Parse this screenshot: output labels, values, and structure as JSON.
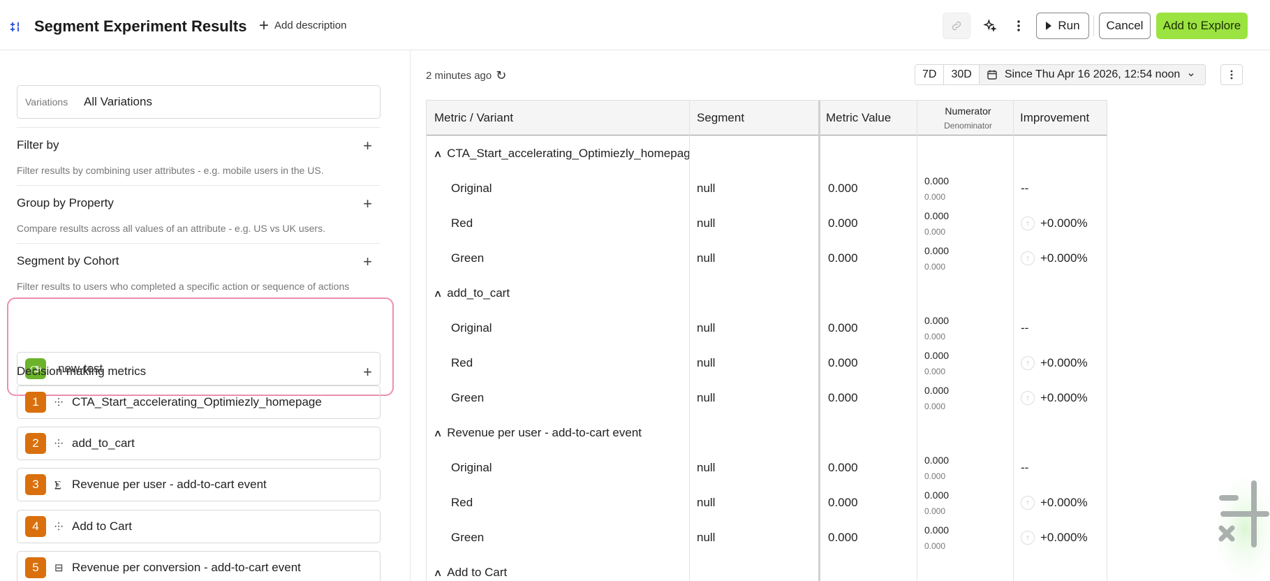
{
  "header": {
    "title": "Segment Experiment Results",
    "add_description": "Add description",
    "run_label": "Run",
    "cancel_label": "Cancel",
    "explore_label": "Add to Explore"
  },
  "variations": {
    "label": "Variations",
    "value": "All Variations"
  },
  "filter_by": {
    "title": "Filter by",
    "desc": "Filter results by combining user attributes - e.g. mobile users in the US."
  },
  "group_by": {
    "title": "Group by Property",
    "desc": "Compare results across all values of an attribute - e.g. US vs UK users."
  },
  "segment_by": {
    "title": "Segment by Cohort",
    "desc": "Filter results to users who completed a specific action or sequence of actions",
    "cohort": "new-test"
  },
  "metrics_section": {
    "title": "Decision-making metrics",
    "items": [
      {
        "num": "1",
        "name": "CTA_Start_accelerating_Optimiezly_homepage",
        "icon": "funnel-icon"
      },
      {
        "num": "2",
        "name": "add_to_cart",
        "icon": "funnel-icon"
      },
      {
        "num": "3",
        "name": "Revenue per user - add-to-cart event",
        "icon": "sum-icon"
      },
      {
        "num": "4",
        "name": "Add to Cart",
        "icon": "funnel-icon"
      },
      {
        "num": "5",
        "name": "Revenue per conversion - add-to-cart event",
        "icon": "calculator-icon"
      }
    ]
  },
  "results": {
    "updated": "2 minutes ago",
    "ranges": [
      "7D",
      "30D"
    ],
    "date_range": "Since Thu Apr 16 2026, 12:54 noon",
    "columns": {
      "metric": "Metric / Variant",
      "segment": "Segment",
      "value": "Metric Value",
      "numerator": "Numerator",
      "denominator": "Denominator",
      "improvement": "Improvement"
    },
    "groups": [
      {
        "name": "CTA_Start_accelerating_Optimiezly_homepage",
        "rows": [
          {
            "variant": "Original",
            "segment": "null",
            "value": "0.000",
            "num": "0.000",
            "den": "0.000",
            "impr": "--"
          },
          {
            "variant": "Red",
            "segment": "null",
            "value": "0.000",
            "num": "0.000",
            "den": "0.000",
            "impr": "+0.000%"
          },
          {
            "variant": "Green",
            "segment": "null",
            "value": "0.000",
            "num": "0.000",
            "den": "0.000",
            "impr": "+0.000%"
          }
        ]
      },
      {
        "name": "add_to_cart",
        "rows": [
          {
            "variant": "Original",
            "segment": "null",
            "value": "0.000",
            "num": "0.000",
            "den": "0.000",
            "impr": "--"
          },
          {
            "variant": "Red",
            "segment": "null",
            "value": "0.000",
            "num": "0.000",
            "den": "0.000",
            "impr": "+0.000%"
          },
          {
            "variant": "Green",
            "segment": "null",
            "value": "0.000",
            "num": "0.000",
            "den": "0.000",
            "impr": "+0.000%"
          }
        ]
      },
      {
        "name": "Revenue per user - add-to-cart event",
        "rows": [
          {
            "variant": "Original",
            "segment": "null",
            "value": "0.000",
            "num": "0.000",
            "den": "0.000",
            "impr": "--"
          },
          {
            "variant": "Red",
            "segment": "null",
            "value": "0.000",
            "num": "0.000",
            "den": "0.000",
            "impr": "+0.000%"
          },
          {
            "variant": "Green",
            "segment": "null",
            "value": "0.000",
            "num": "0.000",
            "den": "0.000",
            "impr": "+0.000%"
          }
        ]
      },
      {
        "name": "Add to Cart",
        "rows": []
      }
    ]
  },
  "colors": {
    "accent_green": "#9be340",
    "metric_badge": "#d9700d",
    "highlight_pink": "#ec8eb1",
    "cohort_green": "#6bb32b"
  }
}
